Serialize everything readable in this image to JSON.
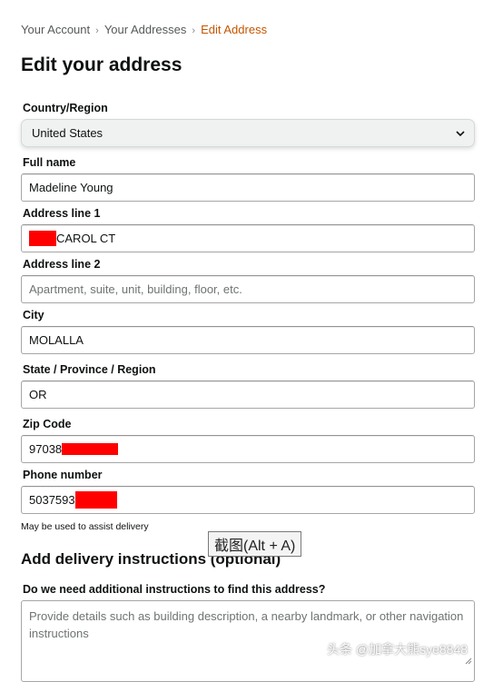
{
  "breadcrumb": {
    "items": [
      "Your Account",
      "Your Addresses"
    ],
    "current": "Edit Address",
    "separator": "›"
  },
  "page_title": "Edit your address",
  "form": {
    "country": {
      "label": "Country/Region",
      "value": "United States"
    },
    "full_name": {
      "label": "Full name",
      "value": "Madeline Young"
    },
    "address1": {
      "label": "Address line 1",
      "value": "CAROL CT",
      "redacted_prefix": true
    },
    "address2": {
      "label": "Address line 2",
      "placeholder": "Apartment, suite, unit, building, floor, etc."
    },
    "city": {
      "label": "City",
      "value": "MOLALLA"
    },
    "state": {
      "label": "State / Province / Region",
      "value": "OR"
    },
    "zip": {
      "label": "Zip Code",
      "value": "97038",
      "redacted_suffix": true
    },
    "phone": {
      "label": "Phone number",
      "value": "5037593",
      "redacted_suffix": true,
      "hint": "May be used to assist delivery"
    }
  },
  "delivery": {
    "section_title": "Add delivery instructions (optional)",
    "question": "Do we need additional instructions to find this address?",
    "placeholder": "Provide details such as building description, a nearby landmark, or other navigation instructions"
  },
  "overlay": {
    "screenshot_tooltip": "截图(Alt + A)",
    "watermark": "头条 @加拿大熊sye8848"
  },
  "colors": {
    "breadcrumb_current": "#c45500",
    "redaction": "#ff0000",
    "select_bg": "#f0f2f2"
  },
  "icons": {
    "select_arrow": "chevron-down-icon",
    "textarea_resize": "resize-grip-icon"
  }
}
